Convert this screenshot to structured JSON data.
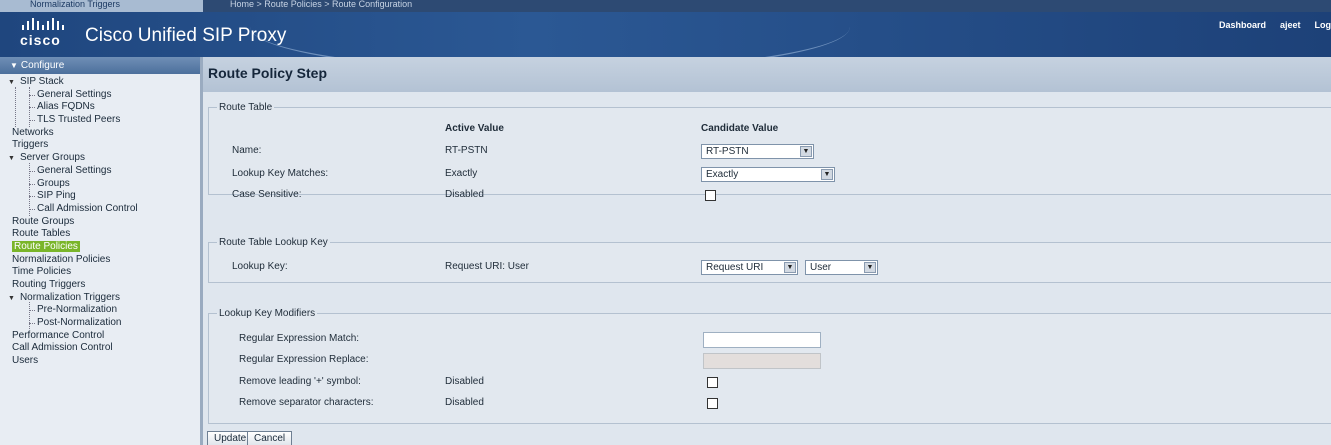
{
  "topstrip": {
    "left_text": "Normalization Triggers",
    "crumb": "Home > Route Policies > Route Configuration"
  },
  "header": {
    "logo_text": "cisco",
    "app_title": "Cisco Unified SIP Proxy",
    "links": [
      "Dashboard",
      "ajeet",
      "Log"
    ]
  },
  "sidebar": {
    "section": "Configure",
    "items": [
      {
        "label": "SIP Stack",
        "level": 0,
        "expanded": true
      },
      {
        "label": "General Settings",
        "level": 1
      },
      {
        "label": "Alias FQDNs",
        "level": 1
      },
      {
        "label": "TLS Trusted Peers",
        "level": 1
      },
      {
        "label": "Networks",
        "level": 0
      },
      {
        "label": "Triggers",
        "level": 0
      },
      {
        "label": "Server Groups",
        "level": 0,
        "expanded": true
      },
      {
        "label": "General Settings",
        "level": 1
      },
      {
        "label": "Groups",
        "level": 1
      },
      {
        "label": "SIP Ping",
        "level": 1
      },
      {
        "label": "Call Admission Control",
        "level": 1
      },
      {
        "label": "Route Groups",
        "level": 0
      },
      {
        "label": "Route Tables",
        "level": 0
      },
      {
        "label": "Route Policies",
        "level": 0,
        "selected": true
      },
      {
        "label": "Normalization Policies",
        "level": 0
      },
      {
        "label": "Time Policies",
        "level": 0
      },
      {
        "label": "Routing Triggers",
        "level": 0
      },
      {
        "label": "Normalization Triggers",
        "level": 0,
        "expanded": true
      },
      {
        "label": "Pre-Normalization",
        "level": 1
      },
      {
        "label": "Post-Normalization",
        "level": 1
      },
      {
        "label": "Performance Control",
        "level": 0
      },
      {
        "label": "Call Admission Control",
        "level": 0
      },
      {
        "label": "Users",
        "level": 0
      }
    ]
  },
  "main": {
    "title": "Route Policy Step",
    "col_active": "Active Value",
    "col_candidate": "Candidate Value",
    "route_table": {
      "legend": "Route Table",
      "name_label": "Name:",
      "name_active": "RT-PSTN",
      "name_candidate": "RT-PSTN",
      "lookup_label": "Lookup Key Matches:",
      "lookup_active": "Exactly",
      "lookup_candidate": "Exactly",
      "case_label": "Case Sensitive:",
      "case_active": "Disabled",
      "case_checked": false
    },
    "lookup_key": {
      "legend": "Route Table Lookup Key",
      "key_label": "Lookup Key:",
      "key_active": "Request URI: User",
      "key_candidate_1": "Request URI",
      "key_candidate_2": "User"
    },
    "modifiers": {
      "legend": "Lookup Key Modifiers",
      "regex_match_label": "Regular Expression Match:",
      "regex_match_value": "",
      "regex_replace_label": "Regular Expression Replace:",
      "regex_replace_value": "",
      "remove_plus_label": "Remove leading '+' symbol:",
      "remove_plus_active": "Disabled",
      "remove_sep_label": "Remove separator characters:",
      "remove_sep_active": "Disabled"
    },
    "buttons": {
      "update": "Update",
      "cancel": "Cancel"
    }
  },
  "colors": {
    "header_blue": "#2b5894",
    "selected_green": "#7ab529"
  }
}
